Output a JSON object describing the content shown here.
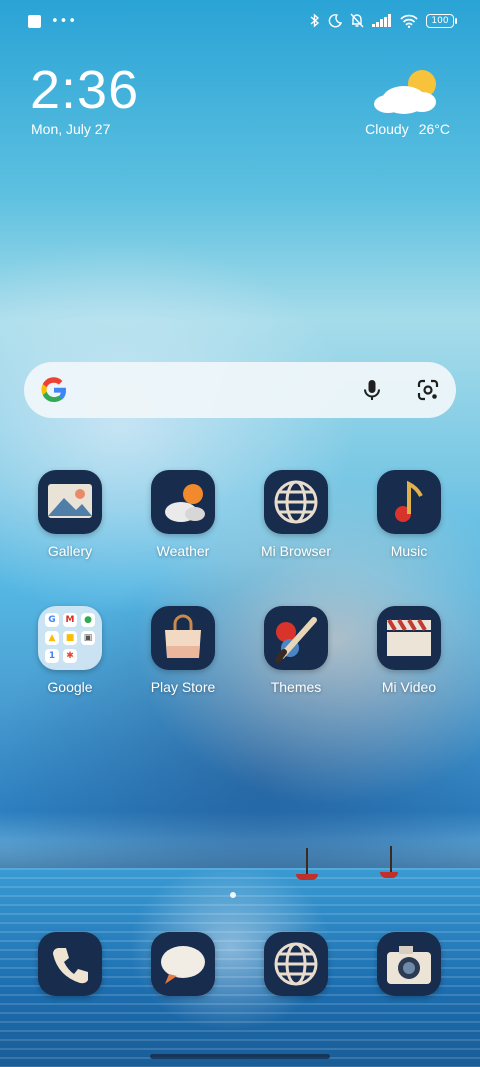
{
  "status_bar": {
    "battery": "100",
    "icons": [
      "bluetooth-icon",
      "moon-icon",
      "bell-off-icon",
      "signal-icon",
      "wifi-icon",
      "battery-icon"
    ]
  },
  "clock": {
    "time": "2:36",
    "date": "Mon, July 27"
  },
  "weather_widget": {
    "condition": "Cloudy",
    "temperature": "26°C",
    "icon": "cloud-sun-icon"
  },
  "search_bar": {
    "icons": [
      "google-icon",
      "microphone-icon",
      "lens-icon"
    ]
  },
  "apps_row1": [
    {
      "label": "Gallery",
      "icon": "gallery-icon"
    },
    {
      "label": "Weather",
      "icon": "weather-icon"
    },
    {
      "label": "Mi Browser",
      "icon": "globe-icon"
    },
    {
      "label": "Music",
      "icon": "music-note-icon"
    }
  ],
  "apps_row2": [
    {
      "label": "Google",
      "icon": "folder-icon"
    },
    {
      "label": "Play Store",
      "icon": "shopping-bag-icon"
    },
    {
      "label": "Themes",
      "icon": "paintbrush-icon"
    },
    {
      "label": "Mi Video",
      "icon": "clapperboard-icon"
    }
  ],
  "dock": [
    {
      "icon": "phone-icon"
    },
    {
      "icon": "messages-icon"
    },
    {
      "icon": "browser-icon"
    },
    {
      "icon": "camera-icon"
    }
  ],
  "colors": {
    "sky_accent": "#2aa3d6",
    "icon_bg": "#182c4e",
    "boat_red": "#c0302b"
  }
}
